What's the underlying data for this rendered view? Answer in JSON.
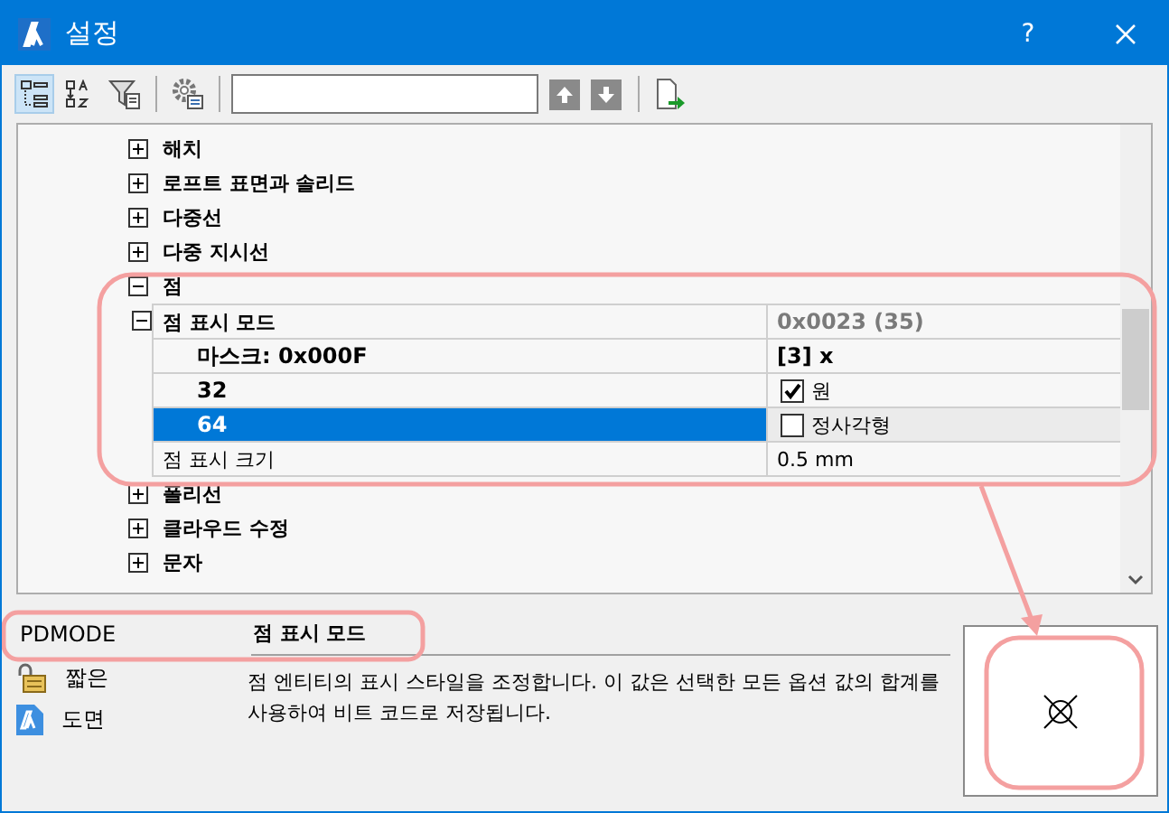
{
  "window": {
    "title": "설정",
    "help": "?"
  },
  "toolbar": {
    "tools": [
      {
        "kind": "categorized",
        "selected": true
      },
      {
        "kind": "alphabetic",
        "selected": false
      },
      {
        "kind": "filter",
        "selected": false
      }
    ]
  },
  "tree": [
    {
      "label": "해치",
      "expanded": false
    },
    {
      "label": "로프트 표면과 솔리드",
      "expanded": false
    },
    {
      "label": "다중선",
      "expanded": false
    },
    {
      "label": "다중 지시선",
      "expanded": false
    },
    {
      "label": "점",
      "expanded": true,
      "properties": [
        {
          "kind": "group",
          "label": "점 표시 모드",
          "expanded": true,
          "value": "0x0023 (35)",
          "selected": false,
          "children": [
            {
              "kind": "mask",
              "label": "마스크: 0x000F",
              "value": "[3] x",
              "selected": false
            },
            {
              "kind": "flag",
              "label": "32",
              "value": "원",
              "checked": true,
              "selected": false
            },
            {
              "kind": "flag",
              "label": "64",
              "value": "정사각형",
              "checked": false,
              "selected": true
            }
          ]
        },
        {
          "kind": "plain",
          "label": "점 표시 크기",
          "value": "0.5 mm",
          "selected": false
        }
      ]
    },
    {
      "label": "폴리선",
      "expanded": false
    },
    {
      "label": "클라우드 수정",
      "expanded": false
    },
    {
      "label": "문자",
      "expanded": false
    }
  ],
  "details": {
    "variable": "PDMODE",
    "title": "점 표시 모드",
    "description": "점 엔티티의 표시 스타일을 조정합니다. 이 값은 선택한 모든 옵션 값의 합계를 사용하여 비트 코드로 저장됩니다.",
    "meta": [
      {
        "kind": "type",
        "label": "짧은"
      },
      {
        "kind": "scope",
        "label": "도면"
      }
    ]
  }
}
